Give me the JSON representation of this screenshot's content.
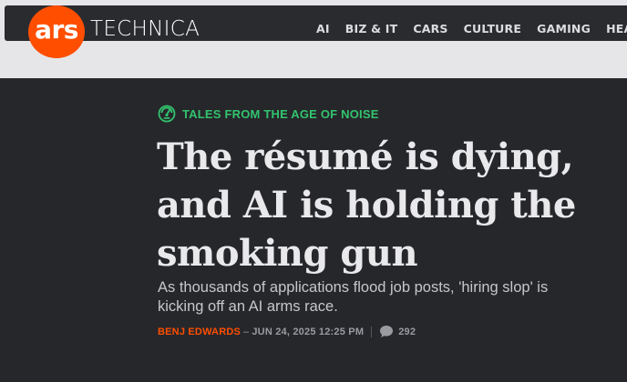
{
  "brand": {
    "logo_text": "ars",
    "logo_word": "TECHNICA",
    "accent_color": "#ff4e00"
  },
  "nav": {
    "items": [
      "AI",
      "BIZ & IT",
      "CARS",
      "CULTURE",
      "GAMING",
      "HEALTH"
    ]
  },
  "article": {
    "kicker": "TALES FROM THE AGE OF NOISE",
    "kicker_icon": "noise-meter-icon",
    "kicker_color": "#32c46e",
    "headline": "The résumé is dying, and AI is holding the smoking gun",
    "dek": "As thousands of applications flood job posts, 'hiring slop' is kicking off an AI arms race.",
    "author": "BENJ EDWARDS",
    "date": "JUN 24, 2025 12:25 PM",
    "comment_icon": "comment-bubble-icon",
    "comment_count": "292"
  }
}
